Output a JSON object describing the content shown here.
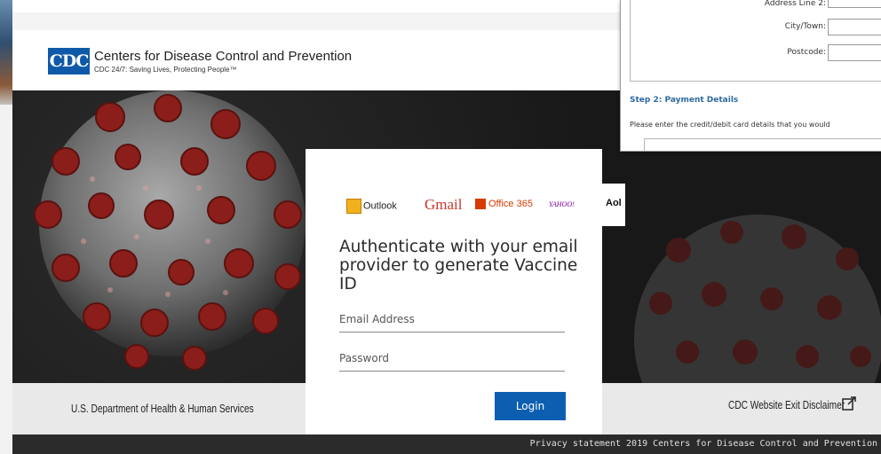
{
  "cdc": {
    "logo": "CDC",
    "title": "Centers for Disease Control and Prevention",
    "tagline": "CDC 24/7: Saving Lives, Protecting People™"
  },
  "providers": {
    "outlook": "Outlook",
    "gmail": "Gmail",
    "office": "Office 365",
    "yahoo": "YAHOO!",
    "aol": "Aol"
  },
  "login": {
    "heading": "Authenticate with your email provider to generate Vaccine ID",
    "email_placeholder": "Email Address",
    "password_placeholder": "Password",
    "button_label": "Login"
  },
  "footer": {
    "hhs": "U.S. Department of Health & Human Services",
    "exit_disclaimer": "CDC Website Exit Disclaimer",
    "bottom_bar": "Privacy statement   2019 Centers for Disease Control and Prevention"
  },
  "payment": {
    "address_line_label": "Address Line 2:",
    "city_label": "City/Town:",
    "postcode_label": "Postcode:",
    "step2_title": "Step 2: Payment Details",
    "step2_desc": "Please enter the credit/debit card details that you would"
  },
  "colors": {
    "cdc_blue": "#0f5aa8",
    "login_button": "#0c5fb0",
    "step_title": "#2c6aa0",
    "virus_spike": "#8b1e1a"
  }
}
